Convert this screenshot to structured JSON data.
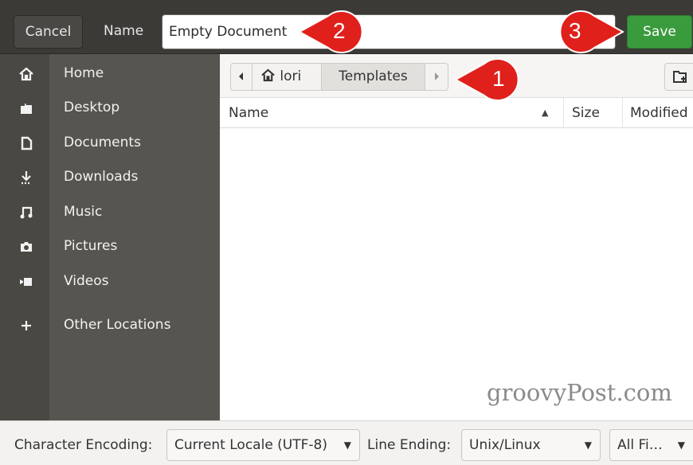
{
  "header": {
    "cancel_label": "Cancel",
    "name_label": "Name",
    "name_value": "Empty Document",
    "save_label": "Save",
    "save_color": "#3a9b3d"
  },
  "sidebar": {
    "items": [
      {
        "label": "Home",
        "icon": "home-icon"
      },
      {
        "label": "Desktop",
        "icon": "folder-icon"
      },
      {
        "label": "Documents",
        "icon": "document-icon"
      },
      {
        "label": "Downloads",
        "icon": "download-icon"
      },
      {
        "label": "Music",
        "icon": "music-icon"
      },
      {
        "label": "Pictures",
        "icon": "camera-icon"
      },
      {
        "label": "Videos",
        "icon": "video-icon"
      },
      {
        "label": "Other Locations",
        "icon": "plus-icon"
      }
    ]
  },
  "pathbar": {
    "home_label": "lori",
    "current_label": "Templates"
  },
  "columns": {
    "name": "Name",
    "size": "Size",
    "modified": "Modified"
  },
  "footer": {
    "encoding_label": "Character Encoding:",
    "encoding_value": "Current Locale (UTF-8)",
    "line_ending_label": "Line Ending:",
    "line_ending_value": "Unix/Linux",
    "filter_value": "All Fi…"
  },
  "callouts": {
    "one": "1",
    "two": "2",
    "three": "3",
    "color": "#e0201b"
  },
  "watermark": "groovyPost.com"
}
